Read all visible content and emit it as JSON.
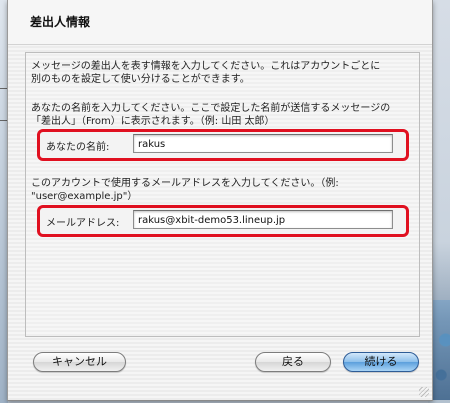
{
  "dialog": {
    "title": "差出人情報",
    "intro_line1": "メッセージの差出人を表す情報を入力してください。これはアカウントごとに",
    "intro_line2": "別のものを設定して使い分けることができます。",
    "name_help_line1": "あなたの名前を入力してください。ここで設定した名前が送信するメッセージの",
    "name_help_line2": "「差出人」（From）に表示されます。（例: 山田 太郎）",
    "name_label": "あなたの名前:",
    "name_value": "rakus",
    "email_help_line1": "このアカウントで使用するメールアドレスを入力してください。（例:",
    "email_help_line2": "\"user@example.jp\"）",
    "email_label": "メールアドレス:",
    "email_value": "rakus@xbit-demo53.lineup.jp"
  },
  "buttons": {
    "cancel": "キャンセル",
    "back": "戻る",
    "continue": "続ける"
  },
  "colors": {
    "highlight": "#e01020",
    "default_button": "#5b9fdc"
  }
}
